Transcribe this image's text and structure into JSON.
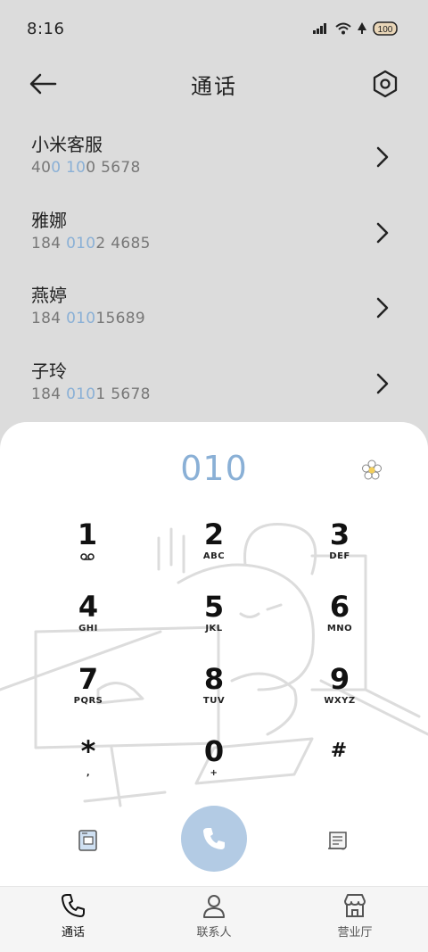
{
  "status_bar": {
    "time": "8:16",
    "battery": "100"
  },
  "header": {
    "title": "通话"
  },
  "contacts": [
    {
      "name": "小米客服",
      "number_parts": [
        "40",
        "0 10",
        "0 5678"
      ]
    },
    {
      "name": "雅娜",
      "number_parts": [
        "184 ",
        "010",
        "2 4685"
      ]
    },
    {
      "name": "燕婷",
      "number_parts": [
        "184 ",
        "010",
        "15689"
      ]
    },
    {
      "name": "子玲",
      "number_parts": [
        "184 ",
        "010",
        "1 5678"
      ]
    }
  ],
  "dialer": {
    "display": "010",
    "keys": [
      {
        "digit": "1",
        "letters": ""
      },
      {
        "digit": "2",
        "letters": "ABC"
      },
      {
        "digit": "3",
        "letters": "DEF"
      },
      {
        "digit": "4",
        "letters": "GHI"
      },
      {
        "digit": "5",
        "letters": "JKL"
      },
      {
        "digit": "6",
        "letters": "MNO"
      },
      {
        "digit": "7",
        "letters": "PQRS"
      },
      {
        "digit": "8",
        "letters": "TUV"
      },
      {
        "digit": "9",
        "letters": "WXYZ"
      },
      {
        "digit": "*",
        "letters": ","
      },
      {
        "digit": "0",
        "letters": "+"
      },
      {
        "digit": "#",
        "letters": ""
      }
    ]
  },
  "bottom_nav": [
    {
      "label": "通话",
      "icon": "phone-icon",
      "active": true
    },
    {
      "label": "联系人",
      "icon": "person-icon",
      "active": false
    },
    {
      "label": "营业厅",
      "icon": "store-icon",
      "active": false
    }
  ],
  "colors": {
    "accent": "#8ab0d6",
    "call_button": "#b3cbe4",
    "background": "#dcdcdc"
  }
}
